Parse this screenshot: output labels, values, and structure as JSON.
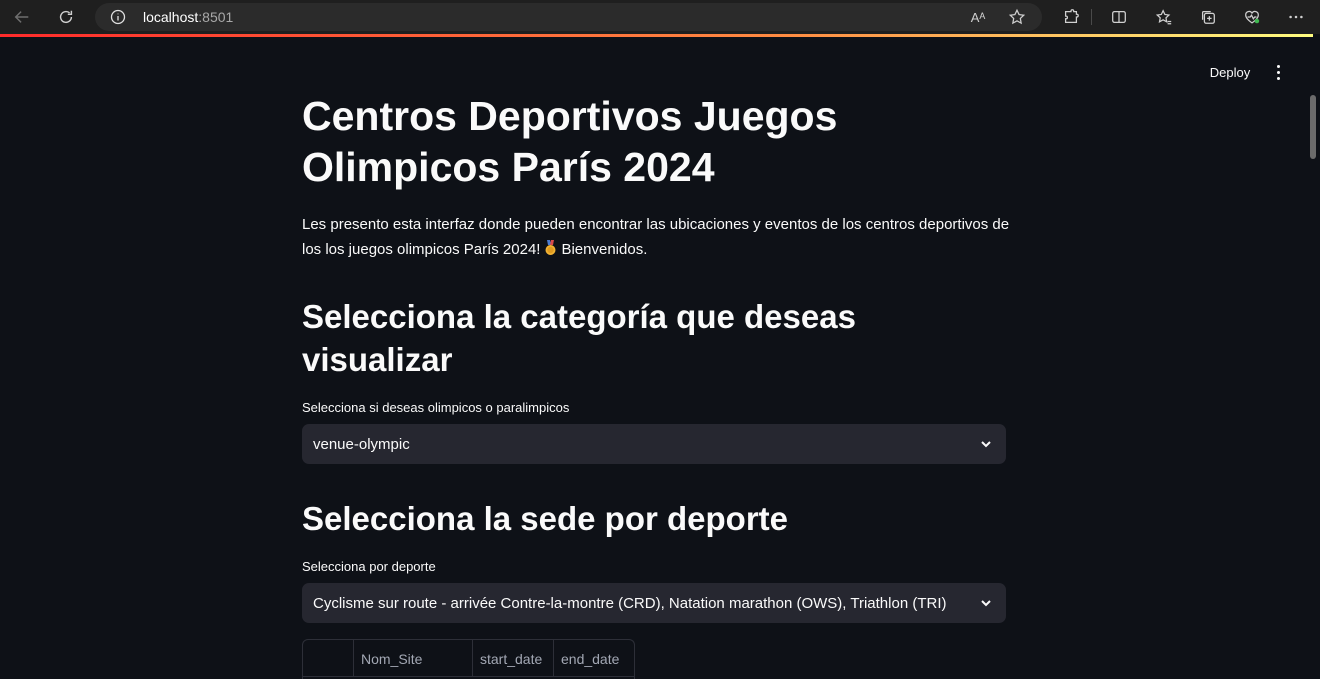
{
  "browser": {
    "url_host": "localhost",
    "url_port": ":8501",
    "read_aloud_icon": "Aᴬ"
  },
  "header": {
    "deploy_label": "Deploy"
  },
  "main": {
    "title": "Centros Deportivos Juegos Olimpicos París 2024",
    "intro_before": "Les presento esta interfaz donde pueden encontrar las ubicaciones y eventos de los centros deportivos de los los juegos olimpicos París 2024!",
    "intro_after": "Bienvenidos.",
    "section1_heading": "Selecciona la categoría que deseas visualizar",
    "select1": {
      "label": "Selecciona si deseas olimpicos o paralimpicos",
      "value": "venue-olympic"
    },
    "section2_heading": "Selecciona la sede por deporte",
    "select2": {
      "label": "Selecciona por deporte",
      "value": "Cyclisme sur route - arrivée Contre-la-montre (CRD), Natation marathon (OWS), Triathlon (TRI)"
    },
    "table": {
      "columns": [
        "",
        "Nom_Site",
        "start_date",
        "end_date"
      ]
    }
  },
  "colors": {
    "background": "#0e1117",
    "widget_bg": "#262730",
    "accent": "#ff4b4b"
  }
}
